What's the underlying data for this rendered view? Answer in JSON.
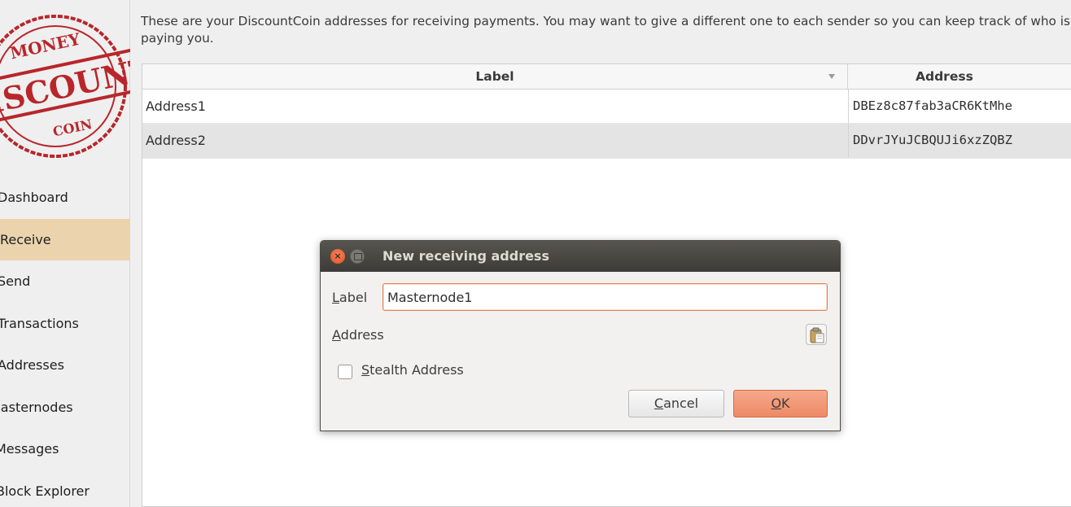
{
  "sidebar": {
    "logo": {
      "icon": "discount-money-coin-stamp-logo",
      "text_top": "MONEY",
      "text_middle": "DISCOUNT",
      "text_bottom": "COIN",
      "color": "#b8262b"
    },
    "items": [
      {
        "label": "Dashboard",
        "active": false
      },
      {
        "label": "Receive",
        "active": true
      },
      {
        "label": "Send",
        "active": false
      },
      {
        "label": "Transactions",
        "active": false
      },
      {
        "label": "Addresses",
        "active": false
      },
      {
        "label": "Masternodes",
        "active": false
      },
      {
        "label": "Messages",
        "active": false
      },
      {
        "label": "Block Explorer",
        "active": false
      }
    ],
    "active_color": "#ebd3ad"
  },
  "main": {
    "description": "These are your DiscountCoin addresses for receiving payments. You may want to give a different one to each sender so you can keep track of who is paying you.",
    "table": {
      "columns": [
        "Label",
        "Address"
      ],
      "rows": [
        {
          "label": "Address1",
          "address": "DBEz8c87fab3aCR6KtMhe"
        },
        {
          "label": "Address2",
          "address": "DDvrJYuJCBQUJi6xzZQBZ"
        }
      ]
    }
  },
  "dialog": {
    "title": "New receiving address",
    "label_prefix": "L",
    "label_rest": "abel",
    "label_value": "Masternode1",
    "address_prefix": "A",
    "address_rest": "ddress",
    "paste_icon": "paste-clipboard-icon",
    "stealth_prefix": "S",
    "stealth_rest": "tealth Address",
    "stealth_checked": false,
    "cancel_prefix": "C",
    "cancel_rest": "ancel",
    "ok_prefix": "O",
    "ok_rest": "K",
    "ok_color": "#ee8a66"
  }
}
